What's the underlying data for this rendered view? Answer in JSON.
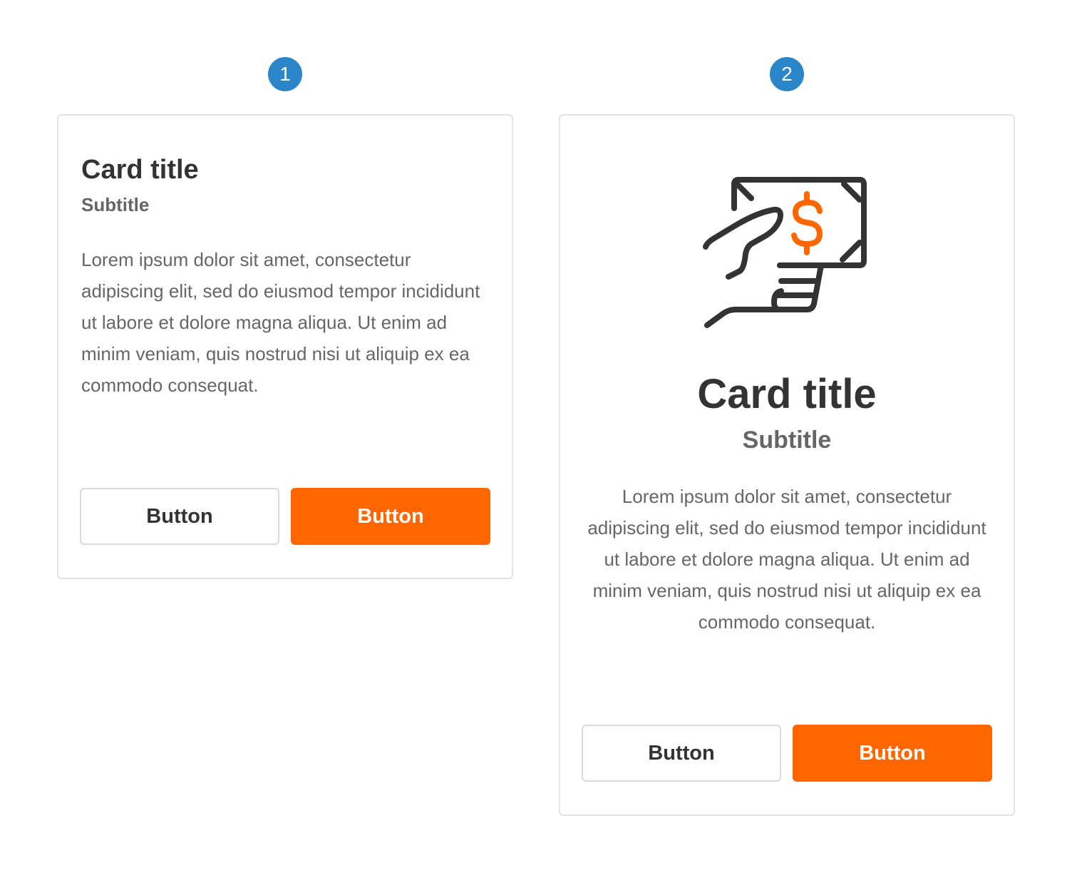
{
  "cards": [
    {
      "badge": "1",
      "title": "Card title",
      "subtitle": "Subtitle",
      "body": "Lorem ipsum dolor sit amet, consectetur adipiscing elit, sed do eiusmod tempor incididunt ut labore et dolore magna aliqua. Ut enim ad minim veniam, quis nostrud nisi ut aliquip ex ea commodo consequat.",
      "secondary_button": "Button",
      "primary_button": "Button"
    },
    {
      "badge": "2",
      "icon": "hand-holding-cash-icon",
      "title": "Card title",
      "subtitle": "Subtitle",
      "body": "Lorem ipsum dolor sit amet, consectetur adipiscing elit, sed do eiusmod tempor incididunt ut labore et dolore magna aliqua. Ut enim ad minim veniam, quis nostrud nisi ut aliquip ex ea commodo consequat.",
      "secondary_button": "Button",
      "primary_button": "Button"
    }
  ],
  "colors": {
    "accent": "#FF6600",
    "badge": "#2B86C9",
    "text_dark": "#333333",
    "text_muted": "#666666",
    "border": "#E2E2E2"
  }
}
